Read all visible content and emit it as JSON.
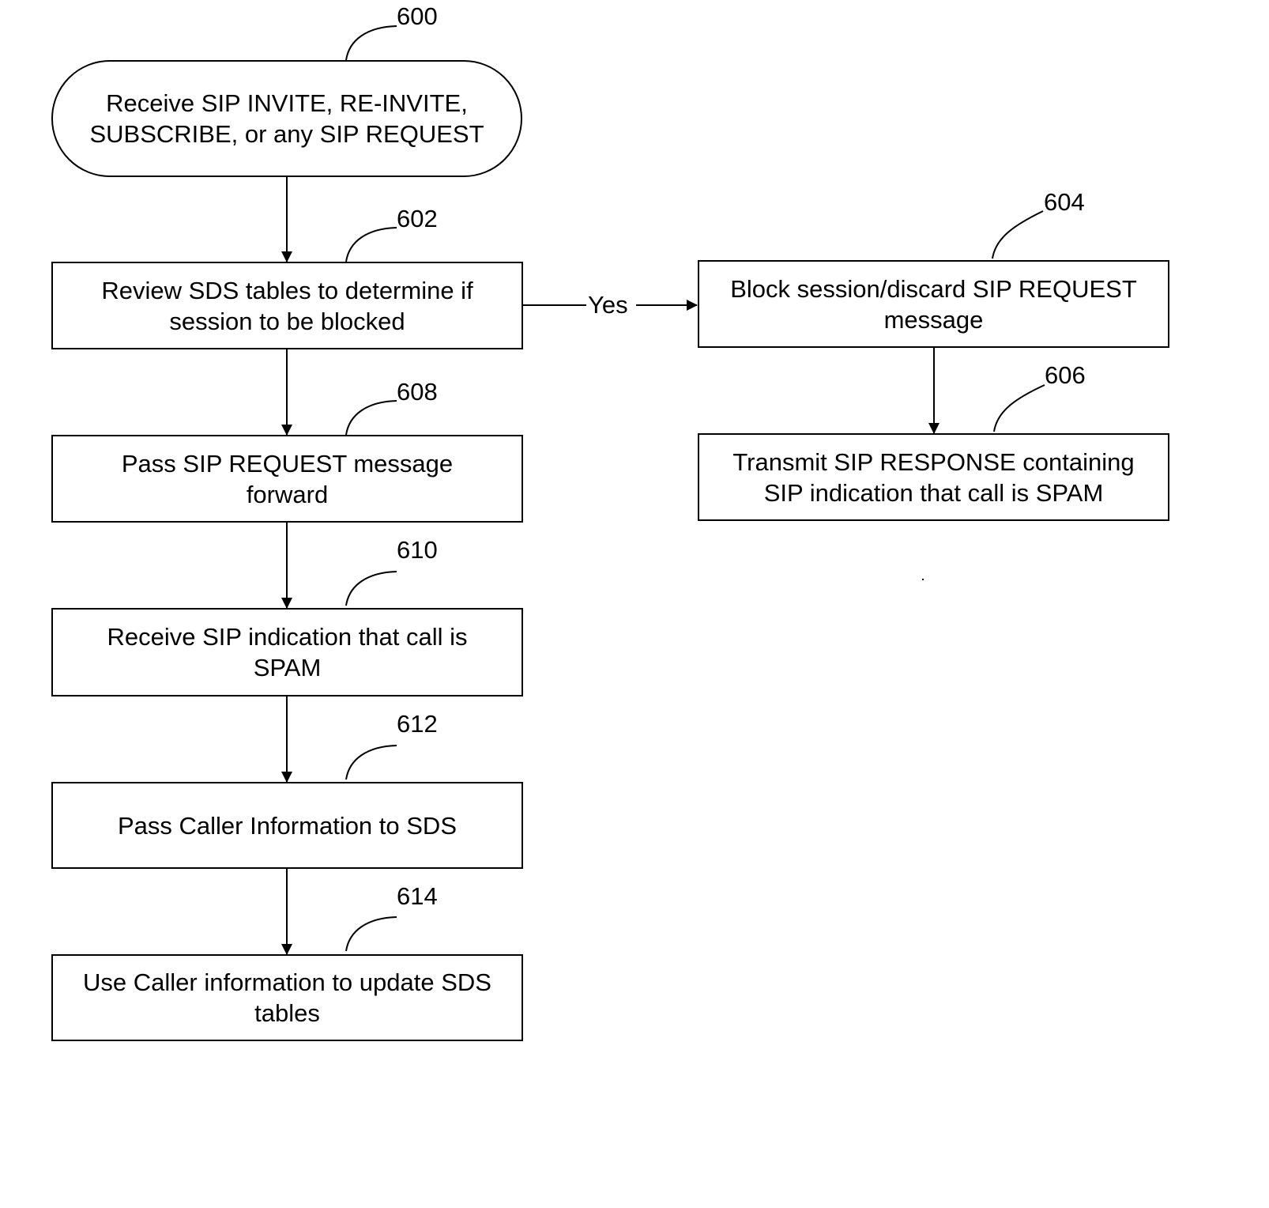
{
  "diagram": {
    "type": "flowchart",
    "nodes": [
      {
        "id": "600",
        "ref": "600",
        "shape": "terminal",
        "text": "Receive SIP INVITE, RE-INVITE, SUBSCRIBE, or any SIP REQUEST"
      },
      {
        "id": "602",
        "ref": "602",
        "shape": "process",
        "text": "Review SDS tables to determine if session to be blocked"
      },
      {
        "id": "604",
        "ref": "604",
        "shape": "process",
        "text": "Block session/discard SIP REQUEST message"
      },
      {
        "id": "606",
        "ref": "606",
        "shape": "process",
        "text": "Transmit SIP RESPONSE containing SIP indication that call is SPAM"
      },
      {
        "id": "608",
        "ref": "608",
        "shape": "process",
        "text": "Pass SIP REQUEST message forward"
      },
      {
        "id": "610",
        "ref": "610",
        "shape": "process",
        "text": "Receive SIP indication that call is SPAM"
      },
      {
        "id": "612",
        "ref": "612",
        "shape": "process",
        "text": "Pass Caller Information to SDS"
      },
      {
        "id": "614",
        "ref": "614",
        "shape": "process",
        "text": "Use Caller information to update SDS tables"
      }
    ],
    "edges": [
      {
        "from": "600",
        "to": "602",
        "label": ""
      },
      {
        "from": "602",
        "to": "604",
        "label": "Yes"
      },
      {
        "from": "604",
        "to": "606",
        "label": ""
      },
      {
        "from": "602",
        "to": "608",
        "label": ""
      },
      {
        "from": "608",
        "to": "610",
        "label": ""
      },
      {
        "from": "610",
        "to": "612",
        "label": ""
      },
      {
        "from": "612",
        "to": "614",
        "label": ""
      }
    ]
  }
}
